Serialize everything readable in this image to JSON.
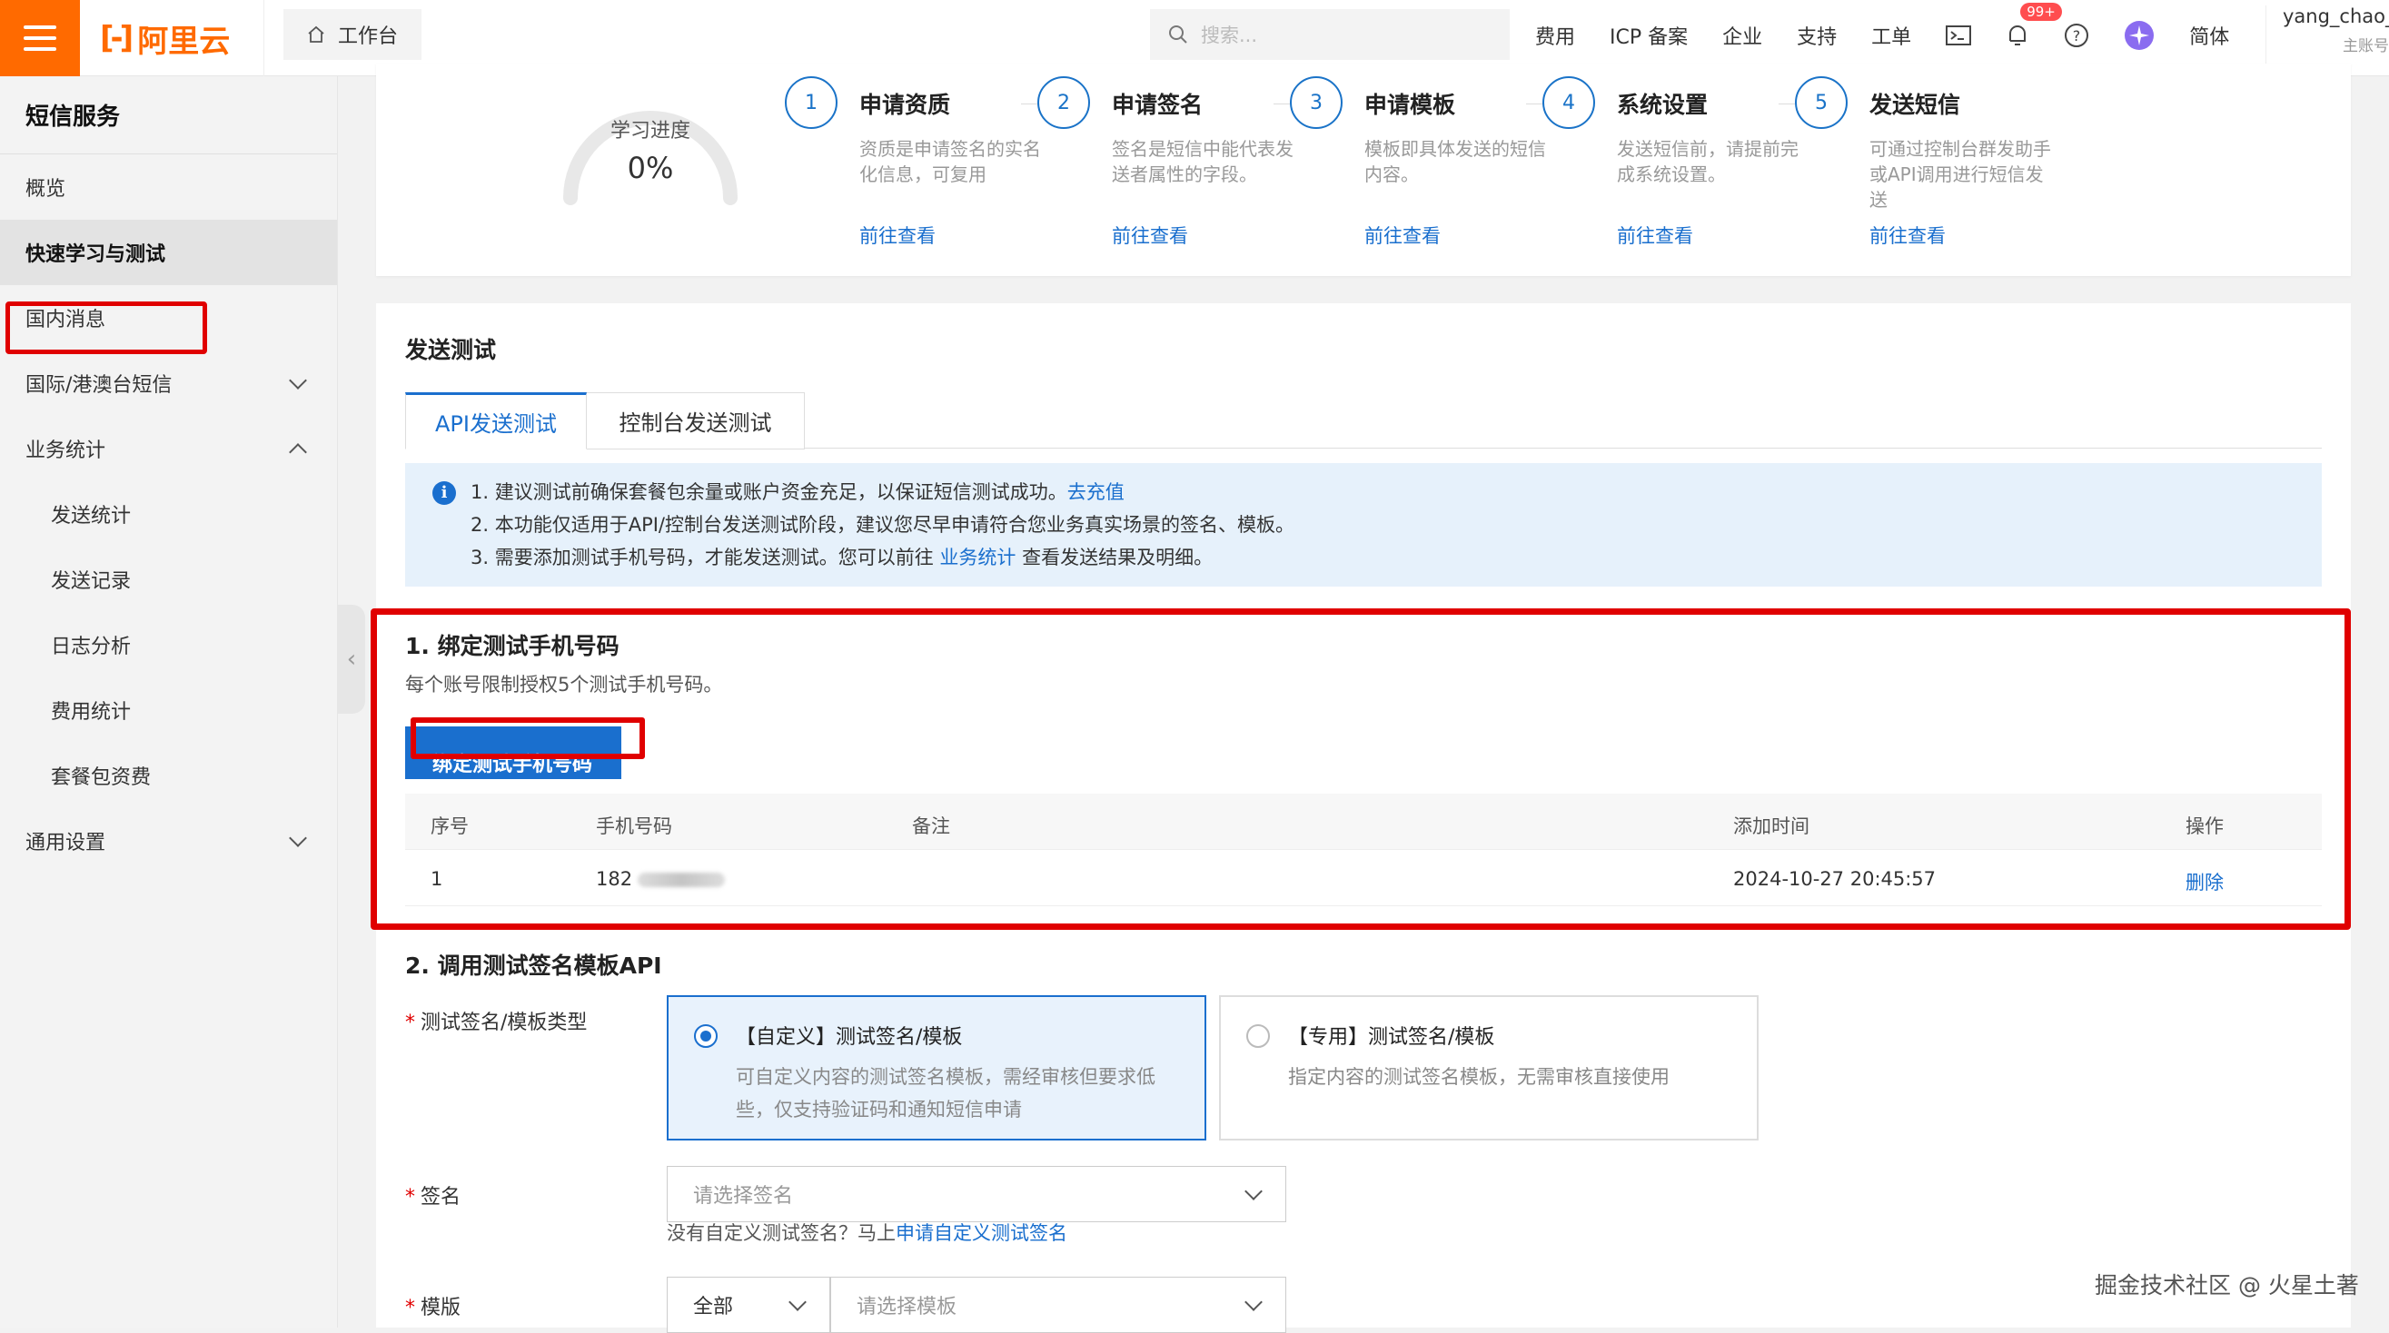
{
  "header": {
    "logo_text": "阿里云",
    "workbench": "工作台",
    "search_placeholder": "搜索...",
    "nav": [
      "费用",
      "ICP 备案",
      "企业",
      "支持",
      "工单"
    ],
    "badge": "99+",
    "lang": "简体",
    "user": "yang_chao_y",
    "user_sub": "主账号"
  },
  "sidebar": {
    "title": "短信服务",
    "items": [
      "概览",
      "快速学习与测试",
      "国内消息",
      "国际/港澳台短信",
      "业务统计",
      "发送统计",
      "发送记录",
      "日志分析",
      "费用统计",
      "套餐包资费",
      "通用设置"
    ]
  },
  "progress": {
    "label": "学习进度",
    "value": "0%",
    "fraction": 0
  },
  "steps": [
    {
      "num": "1",
      "title": "申请资质",
      "desc": "资质是申请签名的实名化信息，可复用",
      "link": "前往查看"
    },
    {
      "num": "2",
      "title": "申请签名",
      "desc": "签名是短信中能代表发送者属性的字段。",
      "link": "前往查看"
    },
    {
      "num": "3",
      "title": "申请模板",
      "desc": "模板即具体发送的短信内容。",
      "link": "前往查看"
    },
    {
      "num": "4",
      "title": "系统设置",
      "desc": "发送短信前，请提前完成系统设置。",
      "link": "前往查看"
    },
    {
      "num": "5",
      "title": "发送短信",
      "desc": "可通过控制台群发助手或API调用进行短信发送",
      "link": "前往查看"
    }
  ],
  "send_test": {
    "title": "发送测试",
    "tabs": [
      "API发送测试",
      "控制台发送测试"
    ],
    "notice": {
      "l1": "1. 建议测试前确保套餐包余量或账户资金充足，以保证短信测试成功。",
      "l1_link": "去充值",
      "l2": "2. 本功能仅适用于API/控制台发送测试阶段，建议您尽早申请符合您业务真实场景的签名、模板。",
      "l3a": "3. 需要添加测试手机号码，才能发送测试。您可以前往 ",
      "l3_link": "业务统计",
      "l3b": " 查看发送结果及明细。"
    }
  },
  "section1": {
    "title": "1. 绑定测试手机号码",
    "desc": "每个账号限制授权5个测试手机号码。",
    "button": "绑定测试手机号码",
    "columns": [
      "序号",
      "手机号码",
      "备注",
      "添加时间",
      "操作"
    ],
    "rows": [
      {
        "index": "1",
        "phone": "182",
        "remark": "",
        "time": "2024-10-27 20:45:57",
        "action": "删除"
      }
    ]
  },
  "section2": {
    "title": "2. 调用测试签名模板API",
    "type_label": "测试签名/模板类型",
    "opt1_title": "【自定义】测试签名/模板",
    "opt1_desc": "可自定义内容的测试签名模板，需经审核但要求低些，仅支持验证码和通知短信申请",
    "opt2_title": "【专用】测试签名/模板",
    "opt2_desc": "指定内容的测试签名模板，无需审核直接使用",
    "sig_label": "签名",
    "sig_placeholder": "请选择签名",
    "sig_hint": "没有自定义测试签名？马上",
    "sig_hint_link": "申请自定义测试签名",
    "tpl_label": "模版",
    "tpl_filter": "全部",
    "tpl_placeholder": "请选择模板"
  },
  "watermark": "掘金技术社区 @ 火星土著"
}
